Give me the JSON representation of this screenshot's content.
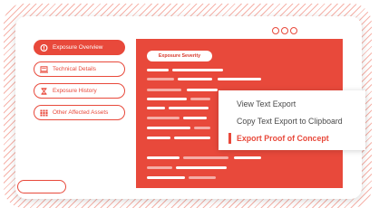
{
  "window": {
    "controls": [
      "dot",
      "dot",
      "dot"
    ]
  },
  "sidebar": {
    "items": [
      {
        "label": "Exposure Overview",
        "icon": "alert-icon",
        "active": true
      },
      {
        "label": "Technical Details",
        "icon": "laptop-icon",
        "active": false
      },
      {
        "label": "Exposure History",
        "icon": "hourglass-icon",
        "active": false
      },
      {
        "label": "Other Affected Assets",
        "icon": "grid-icon",
        "active": false
      }
    ]
  },
  "panel": {
    "heading": "Exposure Severity"
  },
  "context_menu": {
    "items": [
      {
        "label": "View Text Export",
        "active": false
      },
      {
        "label": "Copy Text Export to Clipboard",
        "active": false
      },
      {
        "label": "Export Proof of Concept",
        "active": true
      }
    ]
  },
  "colors": {
    "accent": "#e8493b",
    "hatch": "#f6b3aa",
    "text": "#4a4a4a"
  }
}
